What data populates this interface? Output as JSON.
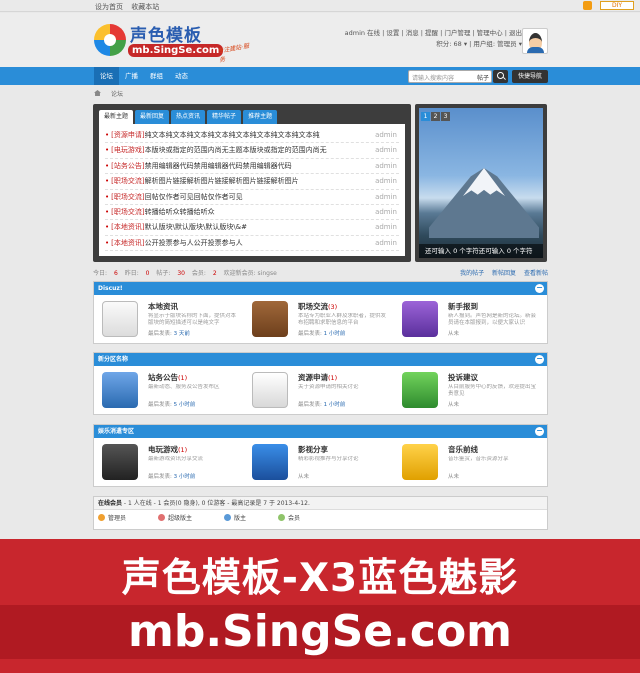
{
  "topbar": {
    "links": [
      "设为首页",
      "收藏本站"
    ],
    "diy": "DIY"
  },
  "header": {
    "logo_name": "声色模板",
    "logo_url": "mb.SingSe.com",
    "slogan": "专注建站·服务",
    "user_line1": "admin 在线 | 设置 | 消息 | 提醒 | 门户管理 | 管理中心 | 退出",
    "user_line2": "积分: 68 ▾ | 用户组: 管理员 ▾"
  },
  "nav": {
    "items": [
      "论坛",
      "广播",
      "群组",
      "动态"
    ],
    "search_placeholder": "请输入搜索内容",
    "search_type": "帖子",
    "quick": "快捷导航"
  },
  "breadcrumb": "论坛",
  "news": {
    "tabs": [
      "最新主题",
      "最新回复",
      "热点资讯",
      "精华帖子",
      "推荐主题"
    ],
    "rows": [
      {
        "tag": "[资源申请]",
        "title": "纯文本纯文本纯文本纯文本纯文本纯文本纯文本纯文本纯",
        "author": "admin"
      },
      {
        "tag": "[电玩游戏]",
        "title": "本版块或指定的范围内尚无主题本版块或指定的范围内尚无",
        "author": "admin"
      },
      {
        "tag": "[站务公告]",
        "title": "禁用编辑器代码禁用编辑器代码禁用编辑器代码",
        "author": "admin"
      },
      {
        "tag": "[职场交流]",
        "title": "解析图片链接解析图片链接解析图片链接解析图片",
        "author": "admin"
      },
      {
        "tag": "[职场交流]",
        "title": "回帖仅作者可见回帖仅作者可见",
        "author": "admin"
      },
      {
        "tag": "[职场交流]",
        "title": "转播给听众转播给听众",
        "author": "admin"
      },
      {
        "tag": "[本地资讯]",
        "title": "默认版块\\默认版块\\默认版块\\&#",
        "author": "admin"
      },
      {
        "tag": "[本地资讯]",
        "title": "公开投票参与人公开投票参与人",
        "author": "admin"
      }
    ]
  },
  "slide": {
    "pages": [
      "1",
      "2",
      "3"
    ],
    "caption": "还可输入 0 个字符还可输入 0 个字符"
  },
  "stats": {
    "today_label": "今日:",
    "today": "6",
    "yesterday_label": "昨日:",
    "yesterday": "0",
    "posts_label": "帖子:",
    "posts": "30",
    "members_label": "会员:",
    "members": "2",
    "welcome": "欢迎新会员: singse",
    "links": [
      "我的帖子",
      "新帖回复"
    ],
    "unread": "查看新帖"
  },
  "groups": [
    {
      "title": "Discuz!",
      "forums": [
        {
          "name": "本地资讯",
          "count": "",
          "desc": "将显示于版块名称的下面，提供对本版块的简短描述可以是纯文字",
          "last": "最后发表:",
          "time": "3 天前"
        },
        {
          "name": "职场交流",
          "count": "(3)",
          "desc": "本站专为职业人群及求职者，提供发布招聘和求职信息的平台",
          "last": "最后发表:",
          "time": "1 小时前"
        },
        {
          "name": "新手报到",
          "count": "",
          "desc": "新人报到。声色网是新的论坛。新会员请在本版报到，以便大家认识",
          "last": "从未",
          "time": ""
        }
      ]
    },
    {
      "title": "新分区名称",
      "forums": [
        {
          "name": "站务公告",
          "count": "(1)",
          "desc": "最新动态、服务及公告发布区",
          "last": "最后发表:",
          "time": "5 小时前"
        },
        {
          "name": "资源申请",
          "count": "(1)",
          "desc": "关于资源申请的相关讨论",
          "last": "最后发表:",
          "time": "1 小时前"
        },
        {
          "name": "投诉建议",
          "count": "",
          "desc": "从目前服务中心的反馈，欢迎提出宝贵意见",
          "last": "从未",
          "time": ""
        }
      ]
    },
    {
      "title": "娱乐消遣专区",
      "forums": [
        {
          "name": "电玩游戏",
          "count": "(1)",
          "desc": "最新游戏资讯分享交流",
          "last": "最后发表:",
          "time": "3 小时前"
        },
        {
          "name": "影视分享",
          "count": "",
          "desc": "精彩影视推荐与分享讨论",
          "last": "从未",
          "time": ""
        },
        {
          "name": "音乐前线",
          "count": "",
          "desc": "音乐鉴赏，音乐资源分享",
          "last": "从未",
          "time": ""
        }
      ]
    }
  ],
  "online": {
    "title": "在线会员",
    "summary": " - 1 人在线 - 1 会员(0 隐身), 0 位游客 - 最高记录是 7 于 2013-4-12.",
    "legend": [
      "管理员",
      "超级版主",
      "版主",
      "会员"
    ]
  },
  "banner": {
    "line1": "声色模板-X3蓝色魅影",
    "line2": "mb.SingSe.com"
  },
  "colors": {
    "nav": "#2a8dd8",
    "banner": "#c8262d",
    "dark": "#3d3d3d"
  }
}
